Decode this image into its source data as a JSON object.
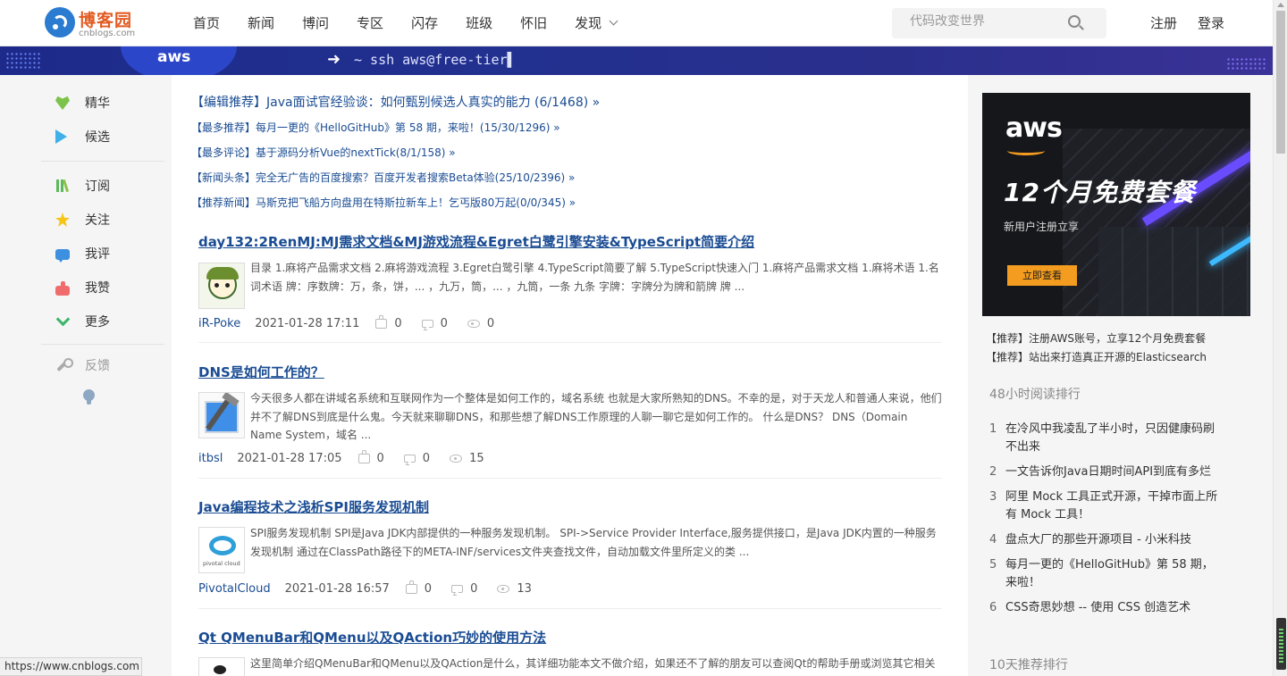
{
  "header": {
    "logo_title": "博客园",
    "logo_sub": "cnblogs.com",
    "nav": [
      "首页",
      "新闻",
      "博问",
      "专区",
      "闪存",
      "班级",
      "怀旧"
    ],
    "nav_more": "发现",
    "search_placeholder": "代码改变世界",
    "register": "注册",
    "login": "登录"
  },
  "banner": {
    "brand": "aws",
    "arrow": "➜",
    "command": "~ ssh aws@free-tier▌"
  },
  "sidebar": {
    "items": [
      "精华",
      "候选",
      "订阅",
      "关注",
      "我评",
      "我赞",
      "更多"
    ],
    "feedback": "反馈"
  },
  "headlines": [
    "【编辑推荐】Java面试官经验谈：如何甄别候选人真实的能力 (6/1468) »",
    "【最多推荐】每月一更的《HelloGitHub》第 58 期，来啦！(15/30/1296) »",
    "【最多评论】基于源码分析Vue的nextTick(8/1/158) »",
    "【新闻头条】完全无广告的百度搜索？百度开发者搜索Beta体验(25/10/2396) »",
    "【推荐新闻】马斯克把飞船方向盘用在特斯拉新车上！乞丐版80万起(0/0/345) »"
  ],
  "articles": [
    {
      "title": "day132:2RenMJ:MJ需求文档&MJ游戏流程&Egret白鹭引擎安装&TypeScript简要介绍",
      "summary": "目录 1.麻将产品需求文档 2.麻将游戏流程 3.Egret白鹭引擎 4.TypeScript简要了解 5.TypeScript快速入门 1.麻将产品需求文档 1.麻将术语 1.名词术语 牌：序数牌：万，条，饼，... ，九万，筒，... ，九筒，一条 九条 字牌：字牌分为牌和箭牌 牌 ...",
      "author": "iR-Poke",
      "date": "2021-01-28 17:11",
      "likes": "0",
      "comments": "0",
      "views": "0"
    },
    {
      "title": "DNS是如何工作的？",
      "summary": "今天很多人都在讲域名系统和互联网作为一个整体是如何工作的，域名系统 也就是大家所熟知的DNS。不幸的是，对于天龙人和普通人来说，他们并不了解DNS到底是什么鬼。今天就来聊聊DNS，和那些想了解DNS工作原理的人聊一聊它是如何工作的。 什么是DNS？ DNS（Domain Name System，域名 ...",
      "author": "itbsl",
      "date": "2021-01-28 17:05",
      "likes": "0",
      "comments": "0",
      "views": "15"
    },
    {
      "title": "Java编程技术之浅析SPI服务发现机制",
      "summary": "SPI服务发现机制 SPI是Java JDK内部提供的一种服务发现机制。 SPI->Service Provider Interface,服务提供接口，是Java JDK内置的一种服务发现机制 通过在ClassPath路径下的META-INF/services文件夹查找文件，自动加载文件里所定义的类 ...",
      "author": "PivotalCloud",
      "date": "2021-01-28 16:57",
      "likes": "0",
      "comments": "0",
      "views": "13",
      "thumb_label": "pivotal cloud"
    },
    {
      "title": "Qt QMenuBar和QMenu以及QAction巧妙的使用方法",
      "summary": "这里简单介绍QMenuBar和QMenu以及QAction是什么，其详细功能本文不做介绍，如果还不了解的朋友可以查阅Qt的帮助手册或浏览其它相关"
    }
  ],
  "right": {
    "ad": {
      "brand": "aws",
      "headline": "12个月免费套餐",
      "sub": "新用户注册立享",
      "cta": "立即查看"
    },
    "recs": [
      "【推荐】注册AWS账号，立享12个月免费套餐",
      "【推荐】站出来打造真正开源的Elasticsearch"
    ],
    "rank48_title": "48小时阅读排行",
    "rank48": [
      {
        "n": "1",
        "t": "在冷风中我凌乱了半小时，只因健康码刷不出来"
      },
      {
        "n": "2",
        "t": "一文告诉你Java日期时间API到底有多烂"
      },
      {
        "n": "3",
        "t": "阿里 Mock 工具正式开源，干掉市面上所有 Mock 工具！"
      },
      {
        "n": "4",
        "t": "盘点大厂的那些开源项目 - 小米科技"
      },
      {
        "n": "5",
        "t": "每月一更的《HelloGitHub》第 58 期，来啦！"
      },
      {
        "n": "6",
        "t": "CSS奇思妙想 -- 使用 CSS 创造艺术"
      }
    ],
    "rank10_title": "10天推荐排行"
  },
  "status_url": "https://www.cnblogs.com"
}
